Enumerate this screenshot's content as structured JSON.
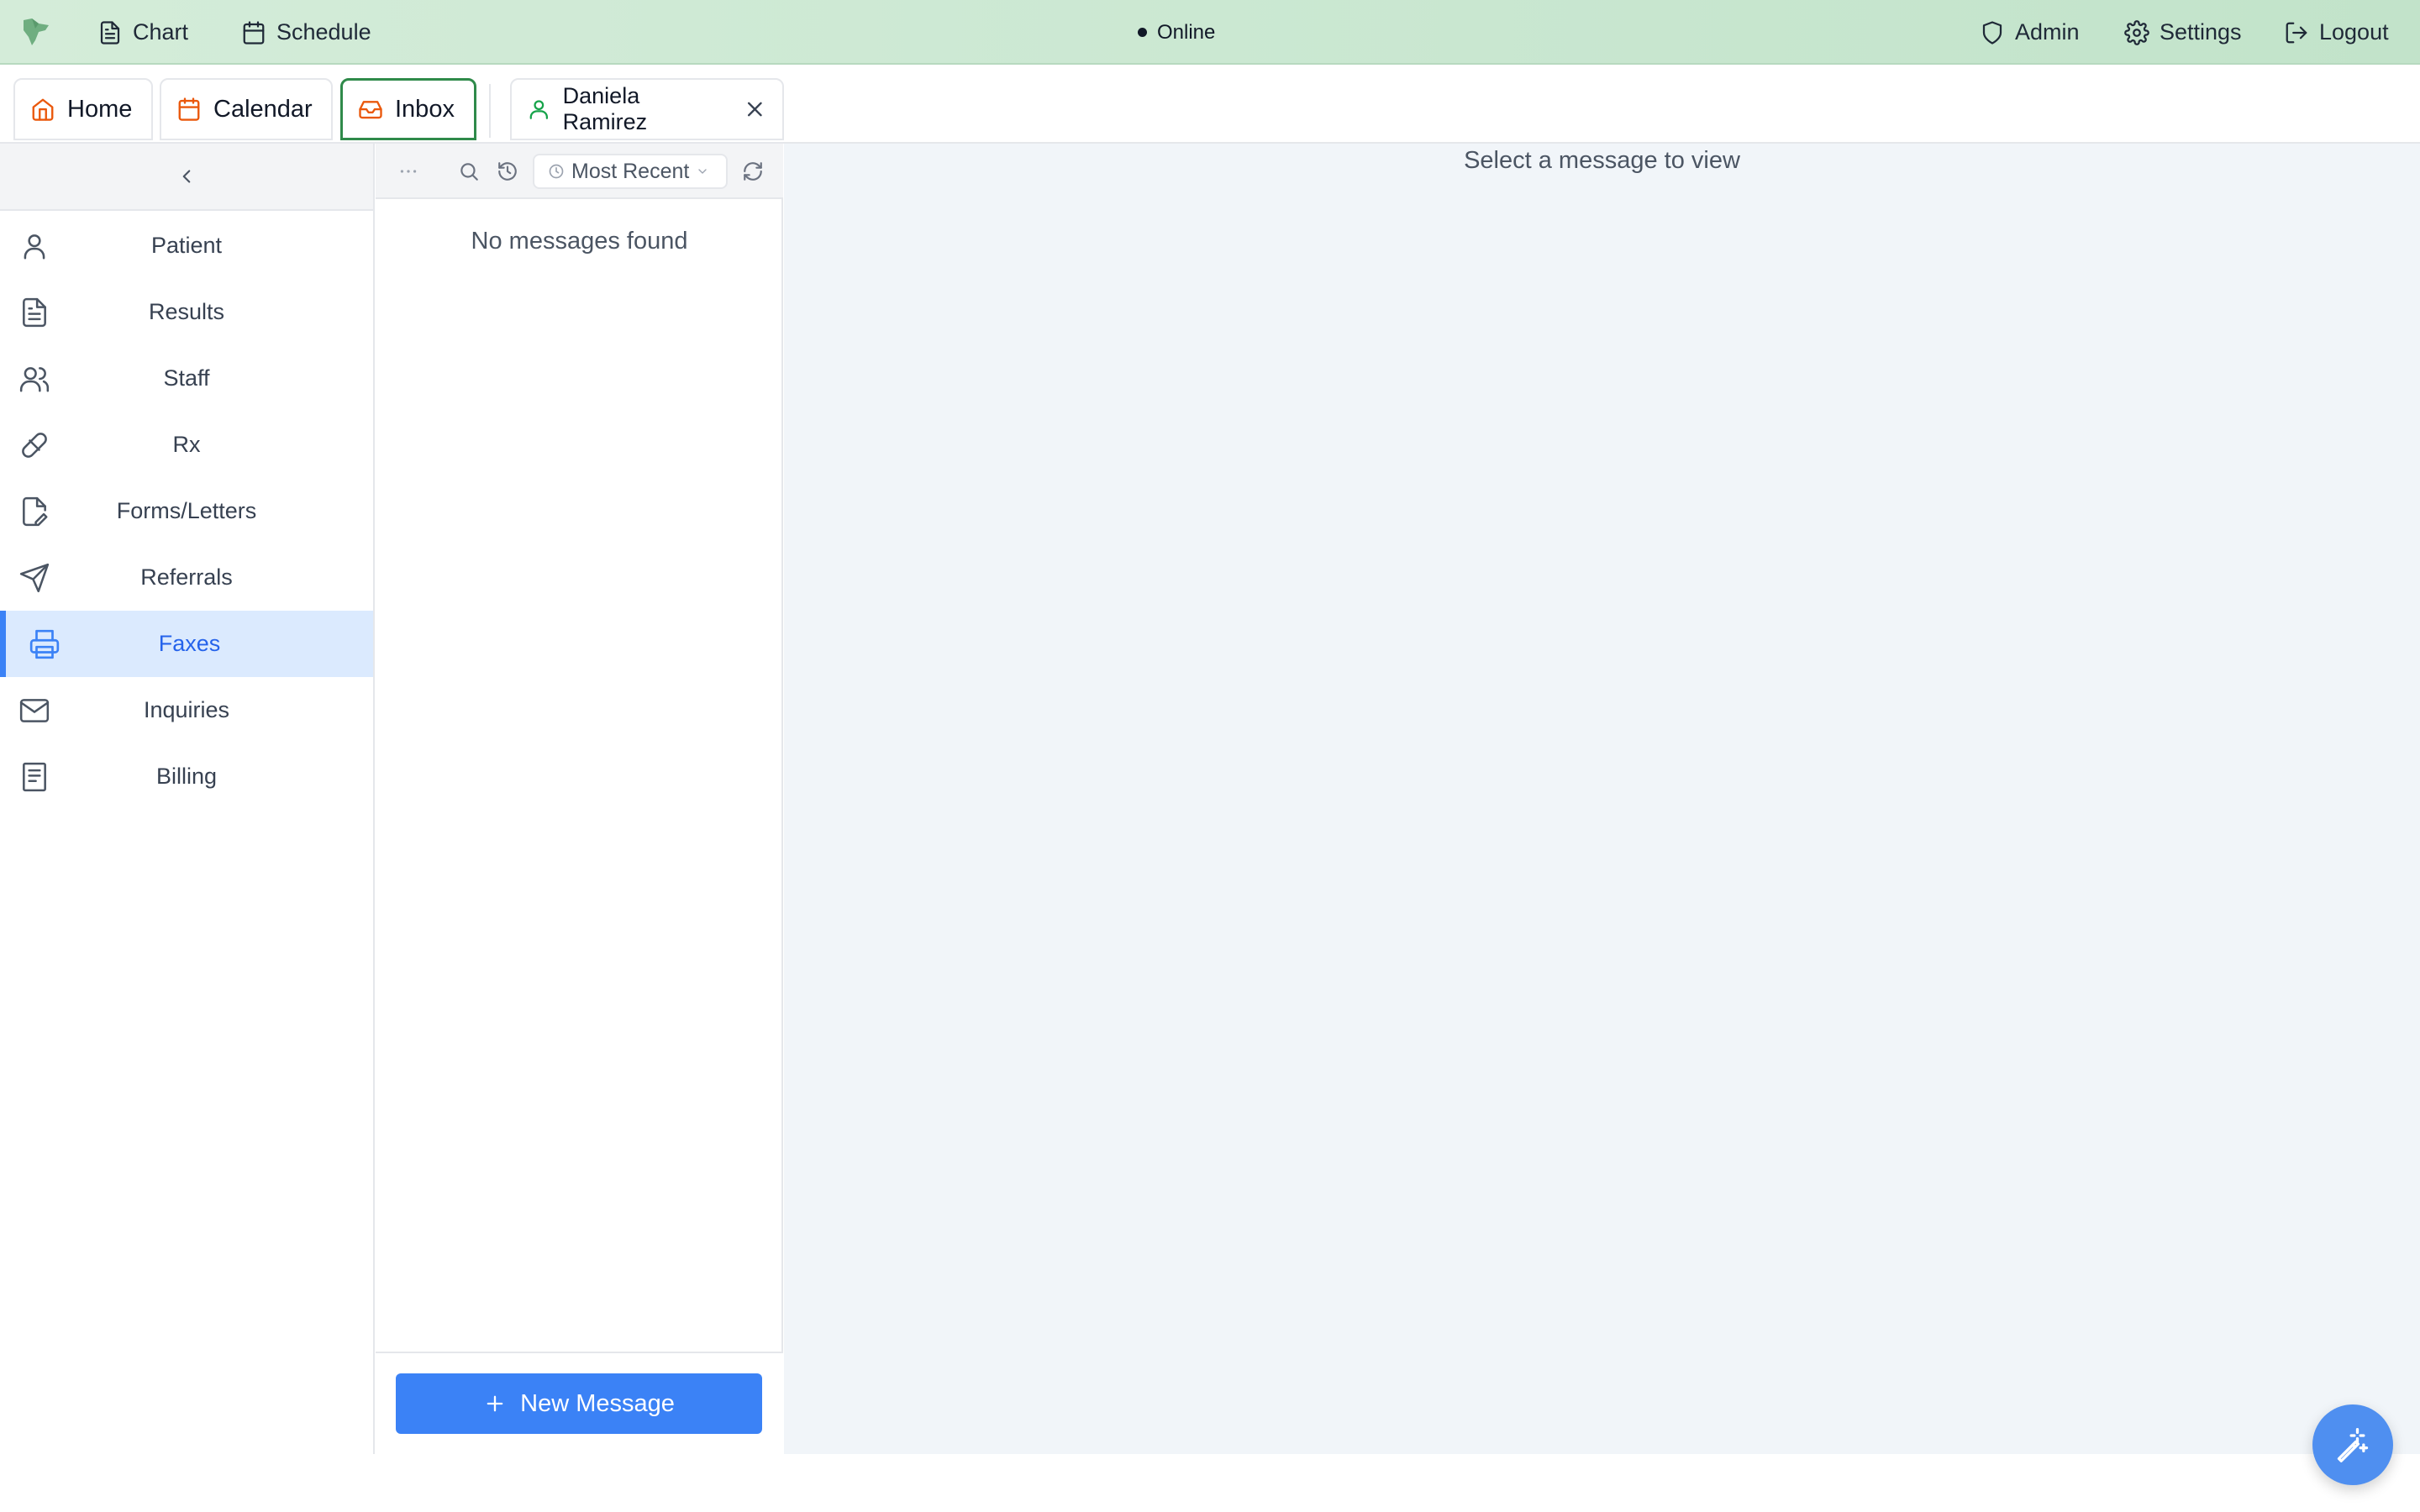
{
  "topbar": {
    "nav": [
      {
        "label": "Chart",
        "icon": "file-text-icon"
      },
      {
        "label": "Schedule",
        "icon": "calendar-icon"
      }
    ],
    "status": "Online",
    "right_nav": [
      {
        "label": "Admin",
        "icon": "shield-icon"
      },
      {
        "label": "Settings",
        "icon": "gear-icon"
      },
      {
        "label": "Logout",
        "icon": "logout-icon"
      }
    ]
  },
  "tabs": [
    {
      "label": "Home",
      "icon": "home-icon"
    },
    {
      "label": "Calendar",
      "icon": "calendar-icon"
    },
    {
      "label": "Inbox",
      "icon": "inbox-icon",
      "active": true
    }
  ],
  "patient_tab": {
    "label": "Daniela Ramirez",
    "icon": "user-icon"
  },
  "sidebar": {
    "items": [
      {
        "label": "Patient",
        "icon": "user-icon"
      },
      {
        "label": "Results",
        "icon": "document-icon"
      },
      {
        "label": "Staff",
        "icon": "users-icon"
      },
      {
        "label": "Rx",
        "icon": "pill-icon"
      },
      {
        "label": "Forms/Letters",
        "icon": "edit-document-icon"
      },
      {
        "label": "Referrals",
        "icon": "send-icon"
      },
      {
        "label": "Faxes",
        "icon": "printer-icon",
        "active": true
      },
      {
        "label": "Inquiries",
        "icon": "mail-icon"
      },
      {
        "label": "Billing",
        "icon": "receipt-icon"
      }
    ]
  },
  "message_list": {
    "sort_label": "Most Recent",
    "empty_text": "No messages found",
    "new_button_label": "New Message"
  },
  "viewer": {
    "empty_text": "Select a message to view"
  },
  "colors": {
    "accent_green": "#2f8a4a",
    "accent_blue": "#3b82f6",
    "icon_orange": "#ea580c",
    "topbar_green": "#cbe8d2"
  }
}
